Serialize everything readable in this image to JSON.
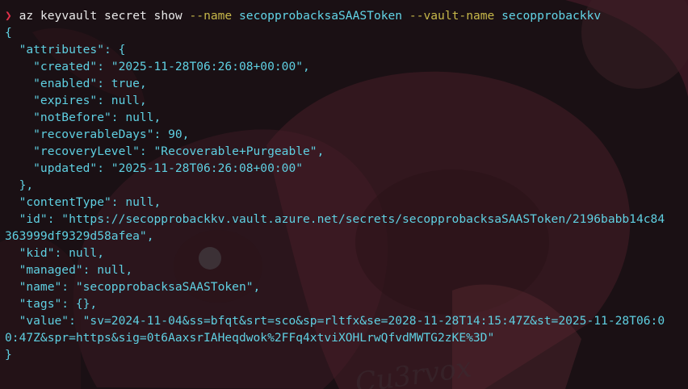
{
  "terminal": {
    "prompt_symbol": "❯",
    "command": {
      "program": "az",
      "words": "keyvault secret show",
      "flag1": "--name",
      "value1": "secopprobacksaSAASToken",
      "flag2": "--vault-name",
      "value2": "secopprobackkv"
    },
    "output_lines": [
      "{",
      "  \"attributes\": {",
      "    \"created\": \"2025-11-28T06:26:08+00:00\",",
      "    \"enabled\": true,",
      "    \"expires\": null,",
      "    \"notBefore\": null,",
      "    \"recoverableDays\": 90,",
      "    \"recoveryLevel\": \"Recoverable+Purgeable\",",
      "    \"updated\": \"2025-11-28T06:26:08+00:00\"",
      "  },",
      "  \"contentType\": null,",
      "  \"id\": \"https://secopprobackkv.vault.azure.net/secrets/secopprobacksaSAASToken/2196babb14c84",
      "363999df9329d58afea\",",
      "  \"kid\": null,",
      "  \"managed\": null,",
      "  \"name\": \"secopprobacksaSAASToken\",",
      "  \"tags\": {},",
      "  \"value\": \"sv=2024-11-04&ss=bfqt&srt=sco&sp=rltfx&se=2028-11-28T14:15:47Z&st=2025-11-28T06:0",
      "0:47Z&spr=https&sig=0t6AaxsrIAHeqdwok%2FFq4xtviXOHLrwQfvdMWTG2zKE%3D\"",
      "}"
    ],
    "colors": {
      "background": "#1a1014",
      "prompt": "#e0304a",
      "flag": "#c7b84a",
      "argument": "#62d4e6",
      "json_text": "#5fd0e2"
    }
  }
}
